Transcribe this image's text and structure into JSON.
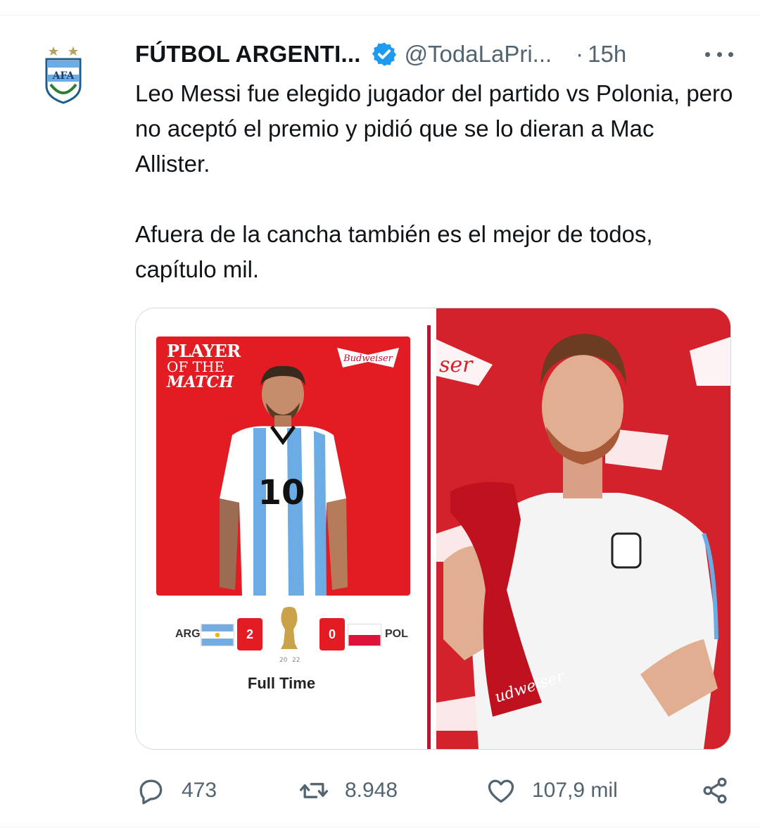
{
  "tweet": {
    "display_name": "FÚTBOL ARGENTI...",
    "handle": "@TodaLaPri...",
    "separator": "·",
    "time": "15h",
    "verified_icon": "verified-badge-icon",
    "text_paragraph_1": "Leo Messi fue elegido jugador del partido vs Polonia, pero no aceptó el premio y pidió que se lo dieran a Mac Allister.",
    "text_paragraph_2": "Afuera de la cancha también es el mejor de todos, capítulo mil."
  },
  "media": {
    "left_image": {
      "title_line_1": "PLAYER",
      "title_line_2": "OF THE",
      "title_line_3": "MATCH",
      "sponsor": "Budweiser",
      "player_number": "10",
      "home_team": "ARG",
      "home_score": "2",
      "away_team": "POL",
      "away_score": "0",
      "year_left": "20",
      "year_right": "22",
      "status": "Full Time"
    },
    "right_image": {
      "sponsor_fragment": "ser",
      "trophy_text": "udweiser"
    }
  },
  "actions": {
    "reply_count": "473",
    "retweet_count": "8.948",
    "like_count": "107,9 mil"
  },
  "colors": {
    "text_primary": "#0f1419",
    "text_secondary": "#536471",
    "verified_blue": "#1d9bf0",
    "potm_red": "#e31b23",
    "divider": "#eff3f4"
  }
}
